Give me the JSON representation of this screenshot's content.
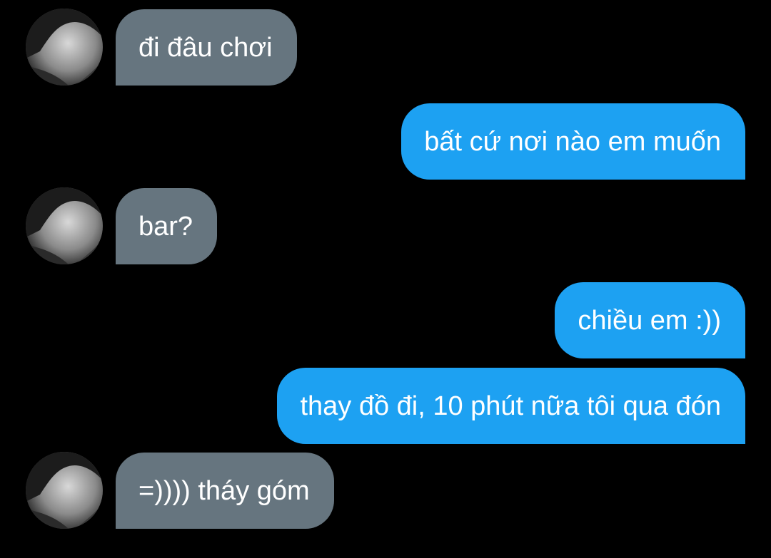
{
  "theme": {
    "background": "#000000",
    "incoming_bubble": "#66757f",
    "outgoing_bubble": "#1da1f2",
    "text": "#ffffff"
  },
  "conversation": {
    "messages": [
      {
        "direction": "incoming",
        "text": "đi đâu chơi",
        "avatar_icon": "user-avatar-icon"
      },
      {
        "direction": "outgoing",
        "text": "bất cứ nơi nào em muốn"
      },
      {
        "direction": "incoming",
        "text": "bar?",
        "avatar_icon": "user-avatar-icon"
      },
      {
        "direction": "outgoing",
        "text": "chiều em :))"
      },
      {
        "direction": "outgoing",
        "text": "thay đồ đi, 10 phút nữa tôi qua đón"
      },
      {
        "direction": "incoming",
        "text": "=)))) tháy góm",
        "avatar_icon": "user-avatar-icon"
      }
    ]
  }
}
